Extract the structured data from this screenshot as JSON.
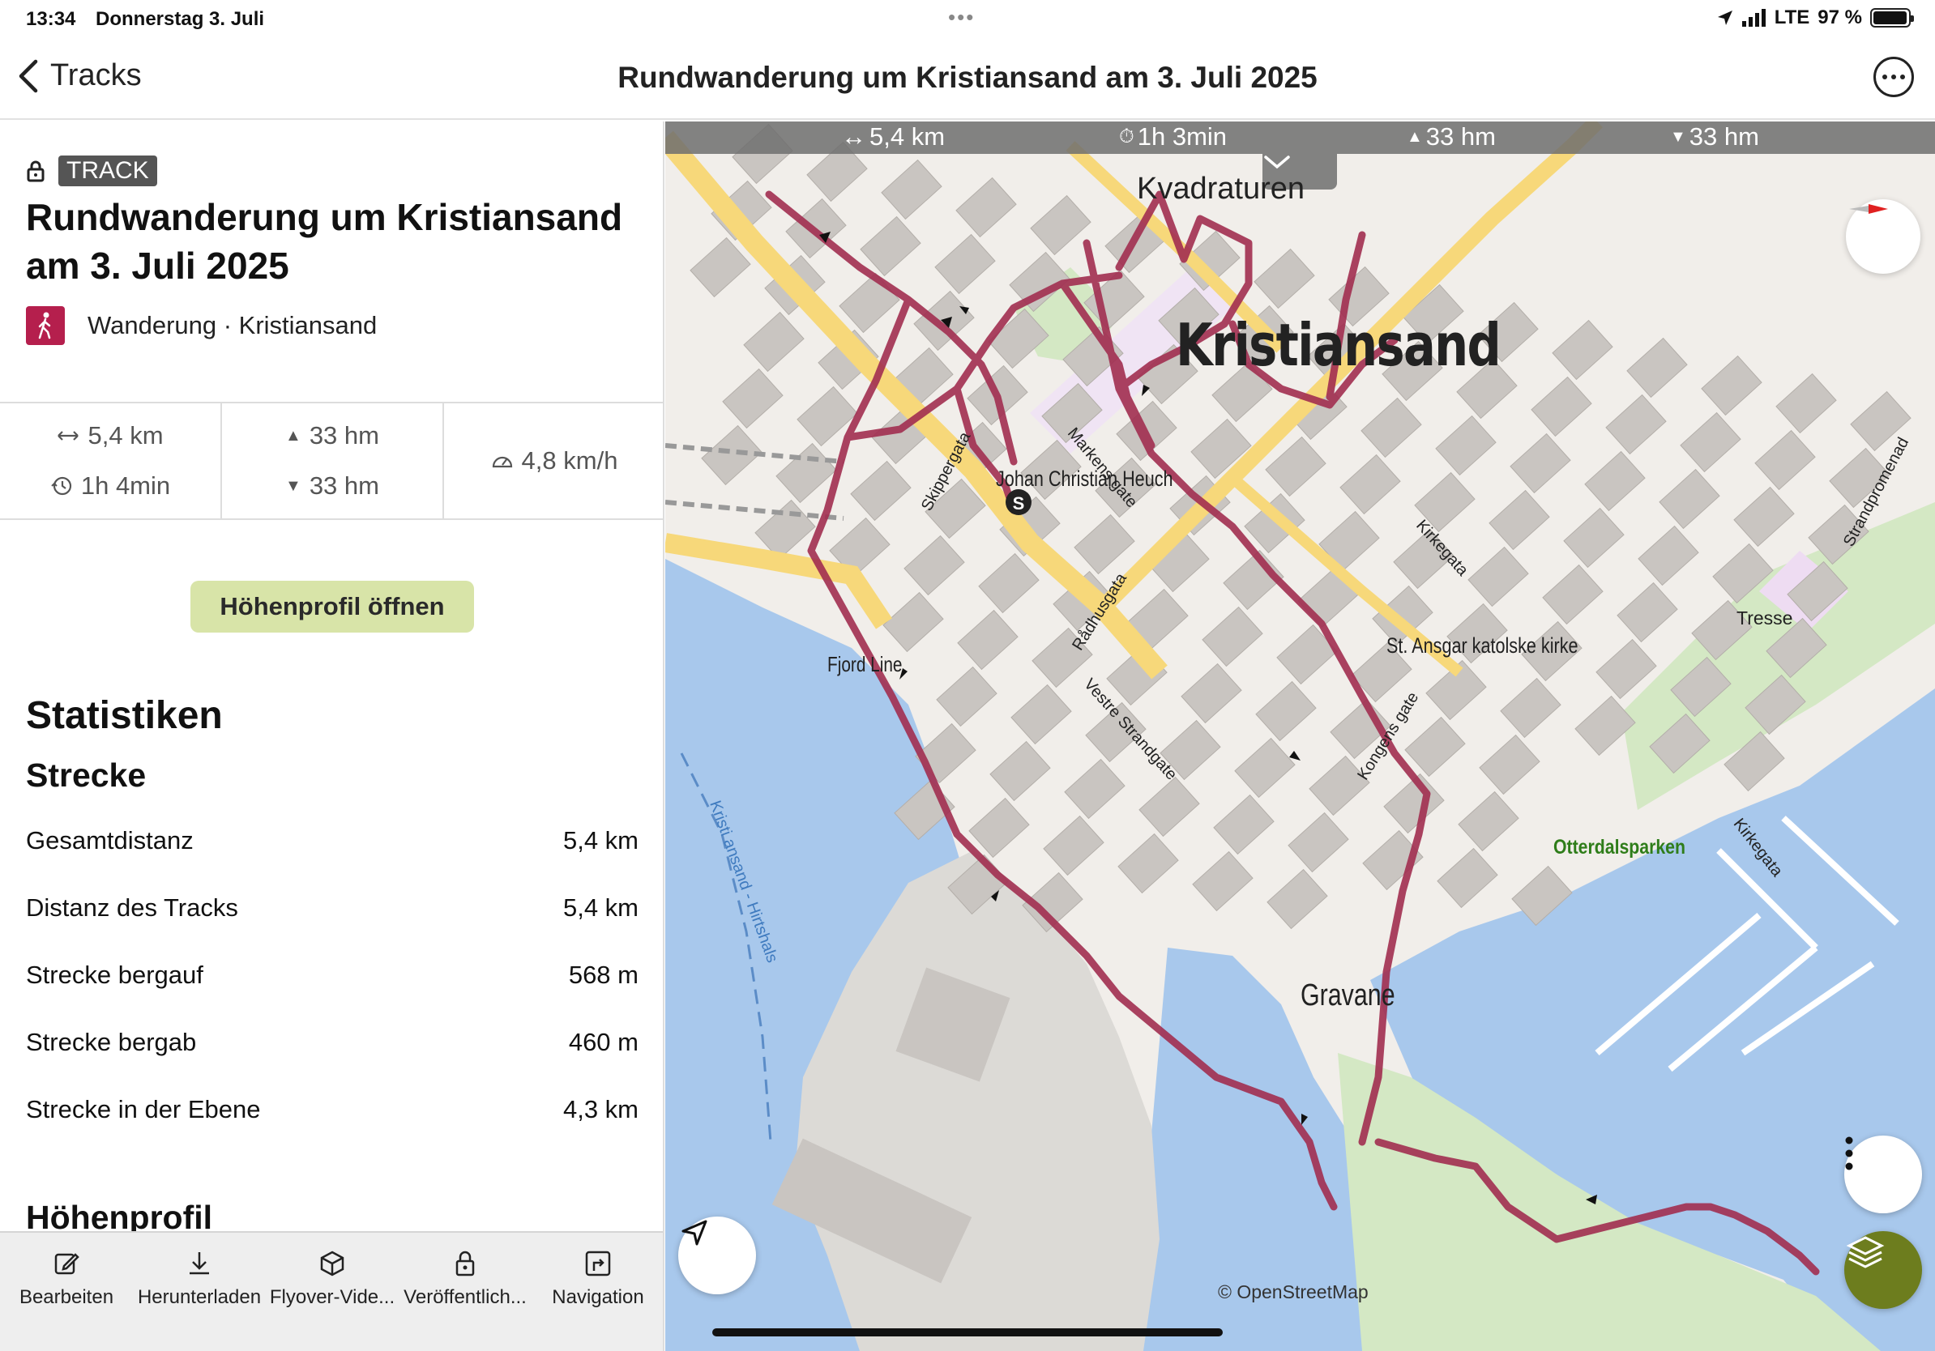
{
  "status_bar": {
    "time": "13:34",
    "date": "Donnerstag 3. Juli",
    "network": "LTE",
    "battery": "97 %",
    "battery_level": 0.97
  },
  "nav": {
    "back_label": "Tracks",
    "title": "Rundwanderung um Kristiansand am 3. Juli 2025"
  },
  "track": {
    "tag": "TRACK",
    "title": "Rundwanderung um Kristiansand am 3. Juli 2025",
    "category": "Wanderung · Kristiansand",
    "summary": {
      "distance": "5,4 km",
      "duration": "1h 4min",
      "ascent": "33 hm",
      "descent": "33 hm",
      "speed": "4,8 km/h"
    },
    "elevation_button": "Höhenprofil öffnen"
  },
  "statistics": {
    "heading": "Statistiken",
    "section": "Strecke",
    "rows": [
      {
        "label": "Gesamtdistanz",
        "value": "5,4 km"
      },
      {
        "label": "Distanz des Tracks",
        "value": "5,4 km"
      },
      {
        "label": "Strecke bergauf",
        "value": "568 m"
      },
      {
        "label": "Strecke bergab",
        "value": "460 m"
      },
      {
        "label": "Strecke in der Ebene",
        "value": "4,3 km"
      }
    ],
    "next_section": "Höhenprofil"
  },
  "toolbar": {
    "items": [
      {
        "label": "Bearbeiten",
        "icon": "edit-icon"
      },
      {
        "label": "Herunterladen",
        "icon": "download-icon"
      },
      {
        "label": "Flyover-Vide...",
        "icon": "cube-icon"
      },
      {
        "label": "Veröffentlich...",
        "icon": "lock-icon"
      },
      {
        "label": "Navigation",
        "icon": "navigation-icon"
      }
    ]
  },
  "map": {
    "topbar": {
      "distance": "5,4 km",
      "duration": "1h 3min",
      "ascent": "33 hm",
      "descent": "33 hm"
    },
    "labels": {
      "city": "Kristiansand",
      "kvadraturen": "Kvadraturen",
      "heuch": "Johan Christian Heuch",
      "fjord_line": "Fjord Line",
      "ansgar": "St. Ansgar katolske kirke",
      "tresse": "Tresse",
      "otterdalsparken": "Otterdalsparken",
      "gravane": "Gravane",
      "skippergata": "Skippergata",
      "markens_gate": "Markens gate",
      "radhusgata": "Rådhusgata",
      "vestre_strandgate": "Vestre Strandgate",
      "kirkegata": "Kirkegata",
      "kongens_gate": "Kongens gate",
      "kirkegata2": "Kirkegata",
      "strandpromenade": "Strandpromenad",
      "ferry": "Kristi ansand - Hirtshals"
    },
    "attribution": "© OpenStreetMap",
    "colors": {
      "track": "#a12d50",
      "water": "#a8c8ec",
      "park": "#d4e8c4",
      "building": "#c9c5c1",
      "road_major": "#f7d87a"
    }
  }
}
